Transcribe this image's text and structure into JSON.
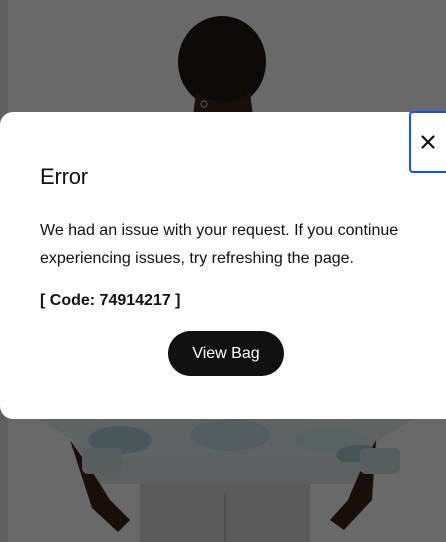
{
  "dialog": {
    "title": "Error",
    "message": "We had an issue with your request. If you continue experiencing issues, try refreshing the page.",
    "code": "[ Code: 74914217 ]",
    "primary_button_label": "View Bag",
    "close_icon": "close-icon"
  },
  "background": {
    "description_icon": "product-photo"
  },
  "colors": {
    "button_bg": "#111111",
    "focus_ring": "#1151ff",
    "scrim": "rgba(0,0,0,0.56)"
  }
}
